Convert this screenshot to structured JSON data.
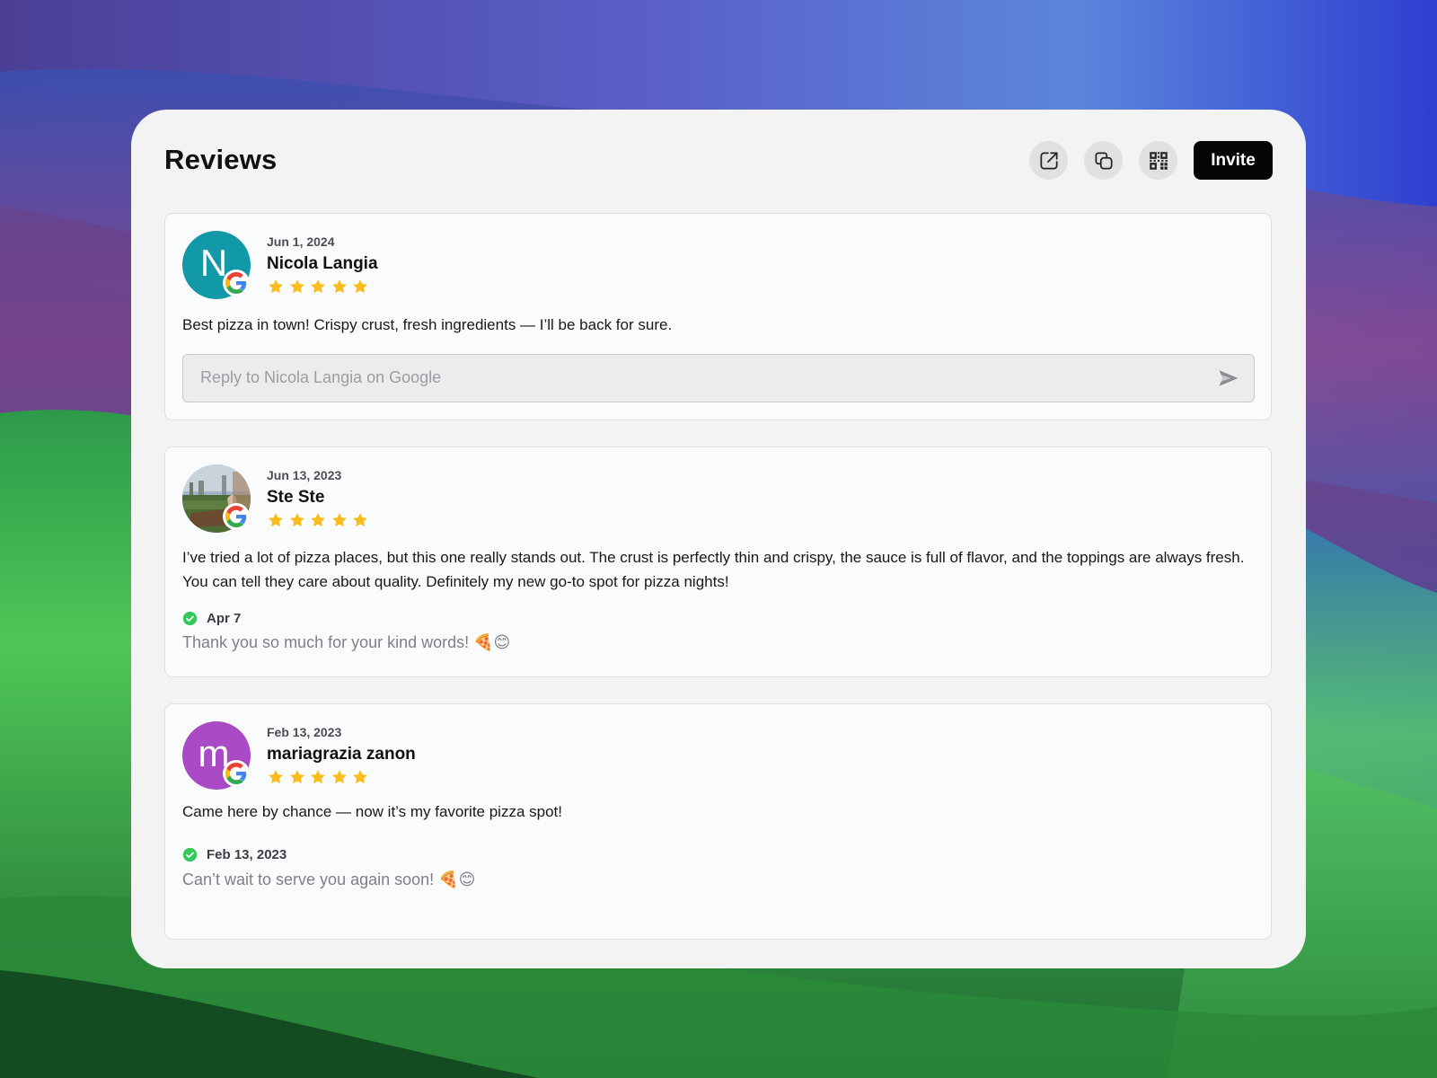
{
  "colors": {
    "panel_bg": "#f3f3f3",
    "invite_bg": "#050505",
    "star": "#fbbd1e",
    "check": "#34c759",
    "avatar_teal": "#1199a8",
    "avatar_purple": "#a94bc4"
  },
  "header": {
    "title": "Reviews",
    "actions": [
      {
        "name": "open-external-icon"
      },
      {
        "name": "copy-icon"
      },
      {
        "name": "qr-code-icon"
      }
    ],
    "invite_label": "Invite"
  },
  "reviews": [
    {
      "avatar_letter": "N",
      "avatar_color": "#1199a8",
      "source_icon": "google-icon",
      "date": "Jun 1, 2024",
      "name": "Nicola Langia",
      "rating": 5,
      "text": "Best pizza in town! Crispy crust, fresh ingredients — I’ll be back for sure.",
      "reply_placeholder": "Reply to Nicola Langia on Google"
    },
    {
      "avatar_photo": "outdoor-photo",
      "source_icon": "google-icon",
      "date": "Jun 13, 2023",
      "name": "Ste Ste",
      "rating": 5,
      "text": "I’ve tried a lot of pizza places, but this one really stands out. The crust is perfectly thin and crispy, the sauce is full of flavor, and the toppings are always fresh. You can tell they care about quality. Definitely my new go-to spot for pizza nights!",
      "owner_reply": {
        "date": "Apr 7",
        "text": "Thank you so much for your kind words! 🍕😊"
      }
    },
    {
      "avatar_letter": "m",
      "avatar_color": "#a94bc4",
      "source_icon": "google-icon",
      "date": "Feb 13, 2023",
      "name": "mariagrazia zanon",
      "rating": 5,
      "text": "Came here by chance — now it’s my favorite pizza spot!",
      "owner_reply": {
        "date": "Feb 13, 2023",
        "text": "Can’t wait to serve you again soon! 🍕😊"
      }
    }
  ]
}
